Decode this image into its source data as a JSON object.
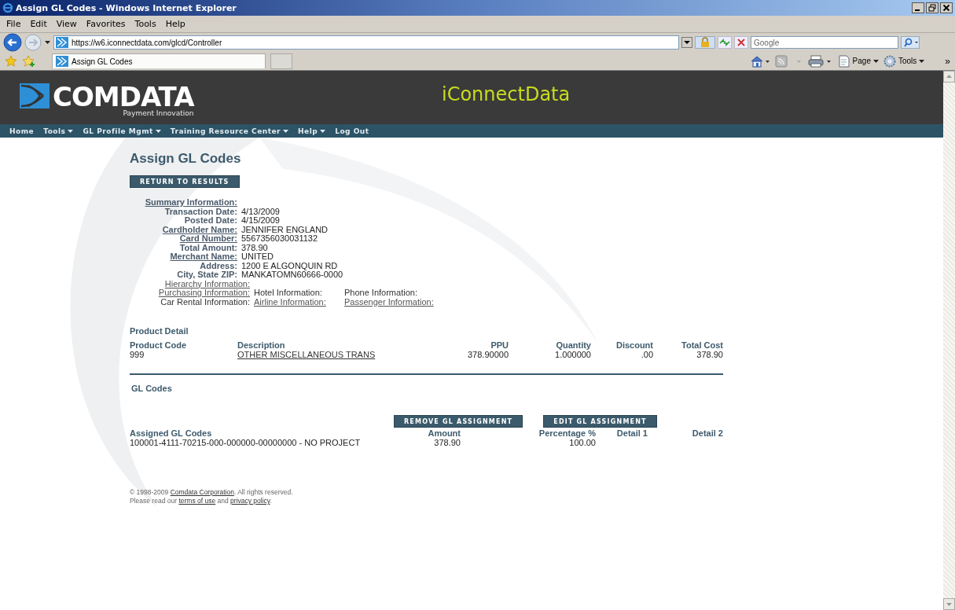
{
  "window": {
    "title": "Assign GL Codes - Windows Internet Explorer"
  },
  "menu": [
    "File",
    "Edit",
    "View",
    "Favorites",
    "Tools",
    "Help"
  ],
  "address": {
    "url": "https://w6.iconnectdata.com/glcd/Controller"
  },
  "search": {
    "placeholder": "Google"
  },
  "tabs": [
    {
      "label": "Assign GL Codes",
      "selected": true
    }
  ],
  "command_bar": [
    "Page",
    "Tools"
  ],
  "chevron": "»",
  "header": {
    "brand": "COMDATA",
    "tagline": "Payment Innovation",
    "app_title": "iConnectData"
  },
  "nav": [
    {
      "label": "Home",
      "dropdown": false
    },
    {
      "label": "Tools",
      "dropdown": true
    },
    {
      "label": "GL Profile Mgmt",
      "dropdown": true
    },
    {
      "label": "Training Resource Center",
      "dropdown": true
    },
    {
      "label": "Help",
      "dropdown": true
    },
    {
      "label": "Log Out",
      "dropdown": false
    }
  ],
  "page": {
    "title": "Assign GL Codes",
    "return_button": "RETURN TO RESULTS",
    "summary_heading": "Summary Information:",
    "fields": [
      {
        "label": "Transaction Date:",
        "value": "4/13/2009",
        "link": false
      },
      {
        "label": "Posted Date:",
        "value": "4/15/2009",
        "link": false
      },
      {
        "label": "Cardholder Name:",
        "value": "JENNIFER ENGLAND",
        "link": true
      },
      {
        "label": "Card Number:",
        "value": "5567356030031132",
        "link": true
      },
      {
        "label": "Total Amount:",
        "value": "378.90",
        "link": false
      },
      {
        "label": "Merchant Name:",
        "value": "UNITED",
        "link": true
      },
      {
        "label": "Address:",
        "value": "1200 E ALGONQUIN RD",
        "link": false
      },
      {
        "label": "City, State ZIP:",
        "value": "MANKATOMN60666-0000",
        "link": false
      }
    ],
    "info_rows": [
      [
        {
          "label": "Hierarchy Information:",
          "link": true
        }
      ],
      [
        {
          "label": "Purchasing Information:",
          "link": true
        },
        {
          "label": "Hotel Information:",
          "link": false
        },
        {
          "label": "Phone Information:",
          "link": false
        }
      ],
      [
        {
          "label": "Car Rental Information:",
          "link": false
        },
        {
          "label": "Airline Information:",
          "link": true
        },
        {
          "label": "Passenger Information:",
          "link": true
        }
      ]
    ]
  },
  "product_detail": {
    "heading": "Product Detail",
    "columns": [
      "Product Code",
      "Description",
      "PPU",
      "Quantity",
      "Discount",
      "Total Cost"
    ],
    "rows": [
      [
        {
          "text": "999",
          "link": false
        },
        {
          "text": "OTHER MISCELLANEOUS TRANS",
          "link": true
        },
        {
          "text": "378.90000",
          "link": false
        },
        {
          "text": "1.000000",
          "link": false
        },
        {
          "text": ".00",
          "link": false
        },
        {
          "text": "378.90",
          "link": false
        }
      ]
    ]
  },
  "gl_codes": {
    "heading": "GL Codes",
    "buttons": [
      "REMOVE GL ASSIGNMENT",
      "EDIT GL ASSIGNMENT"
    ],
    "columns": [
      "Assigned GL Codes",
      "Amount",
      "Percentage %",
      "Detail 1",
      "Detail 2"
    ],
    "rows": [
      [
        "100001-4111-70215-000-000000-00000000 - NO PROJECT",
        "378.90",
        "100.00"
      ]
    ]
  },
  "footer": {
    "lines": [
      [
        {
          "text": "© 1998-2009 ",
          "link": false
        },
        {
          "text": "Comdata Corporation",
          "link": true
        },
        {
          "text": ". All rights reserved.",
          "link": false
        }
      ],
      [
        {
          "text": "Please read our ",
          "link": false
        },
        {
          "text": "terms of use",
          "link": true
        },
        {
          "text": " and ",
          "link": false
        },
        {
          "text": "privacy policy",
          "link": true
        },
        {
          "text": ".",
          "link": false
        }
      ]
    ]
  }
}
